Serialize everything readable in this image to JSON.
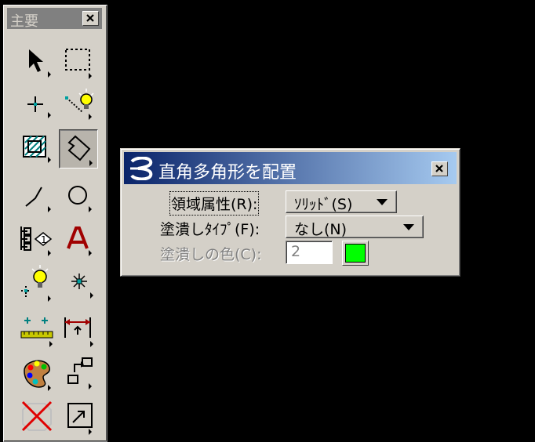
{
  "palette": {
    "title": "主要",
    "tools": [
      {
        "name": "element-selection-tool",
        "icon": "arrow-pointer-icon"
      },
      {
        "name": "fence-tool",
        "icon": "dashed-rectangle-icon"
      },
      {
        "name": "snap-point-tool",
        "icon": "crosshair-point-icon"
      },
      {
        "name": "light-source-tool",
        "icon": "lightbulb-icon"
      },
      {
        "name": "hatch-tool",
        "icon": "hatched-square-icon"
      },
      {
        "name": "place-polygon-tool",
        "icon": "polygon-icon",
        "active": true
      },
      {
        "name": "line-tool",
        "icon": "line-icon"
      },
      {
        "name": "circle-tool",
        "icon": "circle-icon"
      },
      {
        "name": "cell-tool",
        "icon": "cell-library-icon"
      },
      {
        "name": "text-tool",
        "icon": "text-a-icon"
      },
      {
        "name": "place-light-tool",
        "icon": "lightbulb-point-icon"
      },
      {
        "name": "point-tool",
        "icon": "sparkle-point-icon"
      },
      {
        "name": "measure-tool",
        "icon": "measure-ruler-icon"
      },
      {
        "name": "dimension-tool",
        "icon": "dimension-icon"
      },
      {
        "name": "material-tool",
        "icon": "palette-icon"
      },
      {
        "name": "copy-move-tool",
        "icon": "copy-arrow-icon"
      },
      {
        "name": "delete-tool",
        "icon": "delete-x-icon"
      },
      {
        "name": "scale-tool",
        "icon": "scale-icon"
      }
    ]
  },
  "dialog": {
    "title": "直角多角形を配置",
    "area_label": "領域属性(R):",
    "area_value": "ｿﾘｯﾄﾞ(S)",
    "fill_type_label": "塗潰しﾀｲﾌﾟ(F):",
    "fill_type_value": "なし(N)",
    "fill_color_label": "塗潰しの色(C):",
    "fill_color_value": "2",
    "fill_color_hex": "#00ff00",
    "title_gradient": [
      "#0a246a",
      "#a6caf0"
    ]
  }
}
